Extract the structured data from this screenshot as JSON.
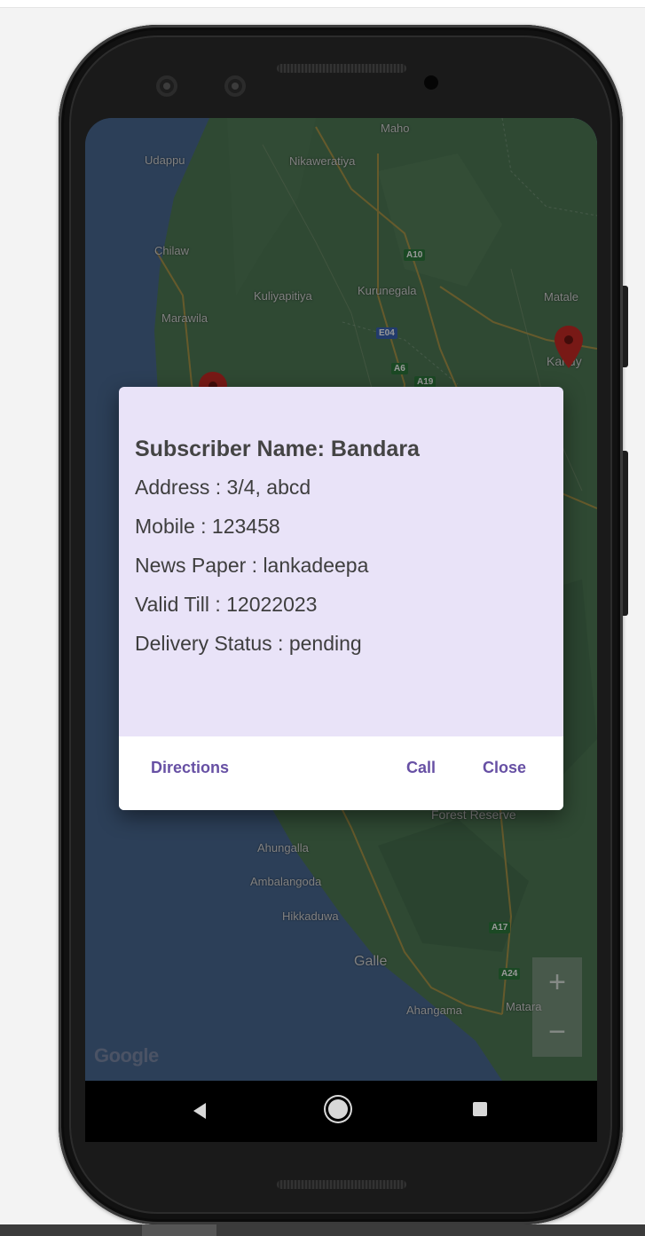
{
  "map": {
    "places": [
      "Maho",
      "Udappu",
      "Nikaweratiya",
      "Chilaw",
      "Kuliyapitiya",
      "Kurunegala",
      "Matale",
      "Marawila",
      "Kandy",
      "Forest Reserve",
      "Ahungalla",
      "Ambalangoda",
      "Hikkaduwa",
      "Galle",
      "Ahangama",
      "Matara"
    ],
    "roads": [
      "A10",
      "E04",
      "A6",
      "A19",
      "A17",
      "A24"
    ],
    "zoom_in": "+",
    "zoom_out": "−",
    "attribution": "Google"
  },
  "dialog": {
    "title": "Subscriber Name: Bandara",
    "address": "Address : 3/4, abcd",
    "mobile": "Mobile : 123458",
    "newspaper": "News Paper : lankadeepa",
    "valid_till": "Valid Till : 12022023",
    "delivery_status": "Delivery Status : pending",
    "directions_label": "Directions",
    "call_label": "Call",
    "close_label": "Close"
  },
  "colors": {
    "dialog_bg": "#e9e3f8",
    "accent": "#6750a4",
    "land": "#4f7a56",
    "water": "#4a6a93",
    "marker": "#c82a26"
  },
  "icons": [
    "back-icon",
    "home-icon",
    "recents-icon",
    "marker-icon"
  ]
}
